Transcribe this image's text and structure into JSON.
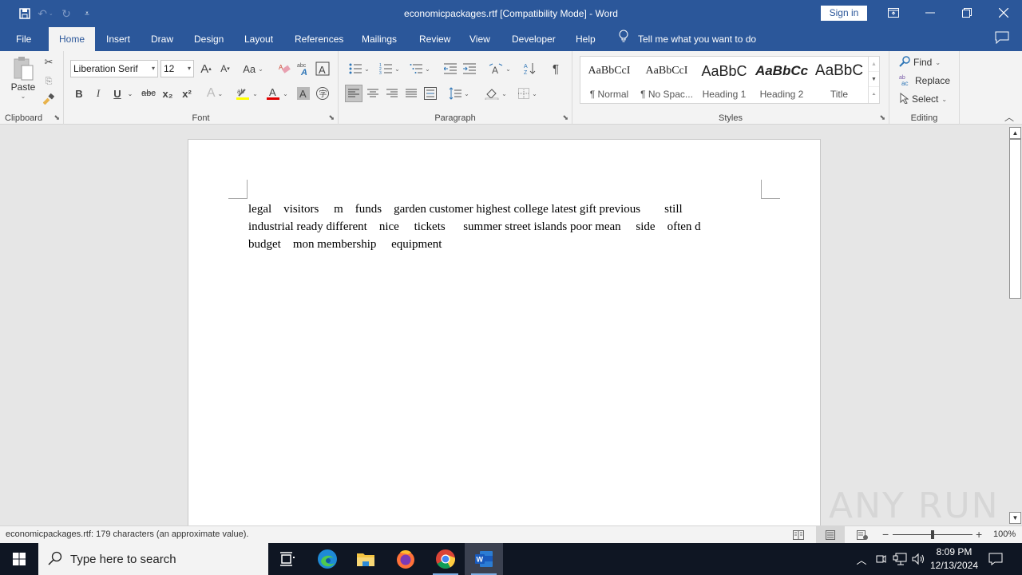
{
  "window": {
    "title": "economicpackages.rtf [Compatibility Mode]  -  Word",
    "sign_in_label": "Sign in",
    "controls": [
      "ribbon-display-options",
      "minimize",
      "restore",
      "close"
    ]
  },
  "quick_access": {
    "icons": [
      "save-icon",
      "undo-icon",
      "redo-icon",
      "customize-qat-icon"
    ]
  },
  "tabs": [
    {
      "label": "File",
      "active": false
    },
    {
      "label": "Home",
      "active": true
    },
    {
      "label": "Insert",
      "active": false
    },
    {
      "label": "Draw",
      "active": false
    },
    {
      "label": "Design",
      "active": false
    },
    {
      "label": "Layout",
      "active": false
    },
    {
      "label": "References",
      "active": false
    },
    {
      "label": "Mailings",
      "active": false
    },
    {
      "label": "Review",
      "active": false
    },
    {
      "label": "View",
      "active": false
    },
    {
      "label": "Developer",
      "active": false
    },
    {
      "label": "Help",
      "active": false
    }
  ],
  "tell_me": {
    "placeholder": "Tell me what you want to do"
  },
  "ribbon": {
    "clipboard": {
      "label": "Clipboard",
      "paste_label": "Paste"
    },
    "font": {
      "label": "Font",
      "font_name": "Liberation Serif",
      "font_size": "12",
      "change_case_label": "Aa",
      "bold": "B",
      "italic": "I",
      "underline": "U",
      "strikethrough": "abc",
      "subscript": "x₂",
      "superscript": "x²",
      "highlight_color": "#ffff00",
      "font_color": "#e00000"
    },
    "paragraph": {
      "label": "Paragraph"
    },
    "styles": {
      "label": "Styles",
      "items": [
        {
          "preview": "AaBbCcI",
          "name": "¶ Normal"
        },
        {
          "preview": "AaBbCcI",
          "name": "¶ No Spac..."
        },
        {
          "preview": "AaBbC",
          "name": "Heading 1"
        },
        {
          "preview": "AaBbCc",
          "name": "Heading 2"
        },
        {
          "preview": "AaBbC",
          "name": "Title"
        }
      ]
    },
    "editing": {
      "label": "Editing",
      "find_label": "Find",
      "replace_label": "Replace",
      "select_label": "Select"
    }
  },
  "document": {
    "lines": [
      "legal    visitors     m    funds    garden customer highest college latest gift previous        still",
      "industrial ready different    nice     tickets      summer street islands poor mean     side    often d",
      "budget    mon membership     equipment"
    ]
  },
  "status_bar": {
    "text": "economicpackages.rtf: 179 characters (an approximate value).",
    "zoom_level": "100%",
    "zoom_percent": 100,
    "active_view": "print-layout"
  },
  "watermark": "ANY RUN",
  "taskbar": {
    "search_placeholder": "Type here to search",
    "apps": [
      "task-view",
      "edge",
      "file-explorer",
      "firefox",
      "chrome",
      "word"
    ],
    "active_app": "word",
    "time": "8:09 PM",
    "date": "12/13/2024"
  }
}
